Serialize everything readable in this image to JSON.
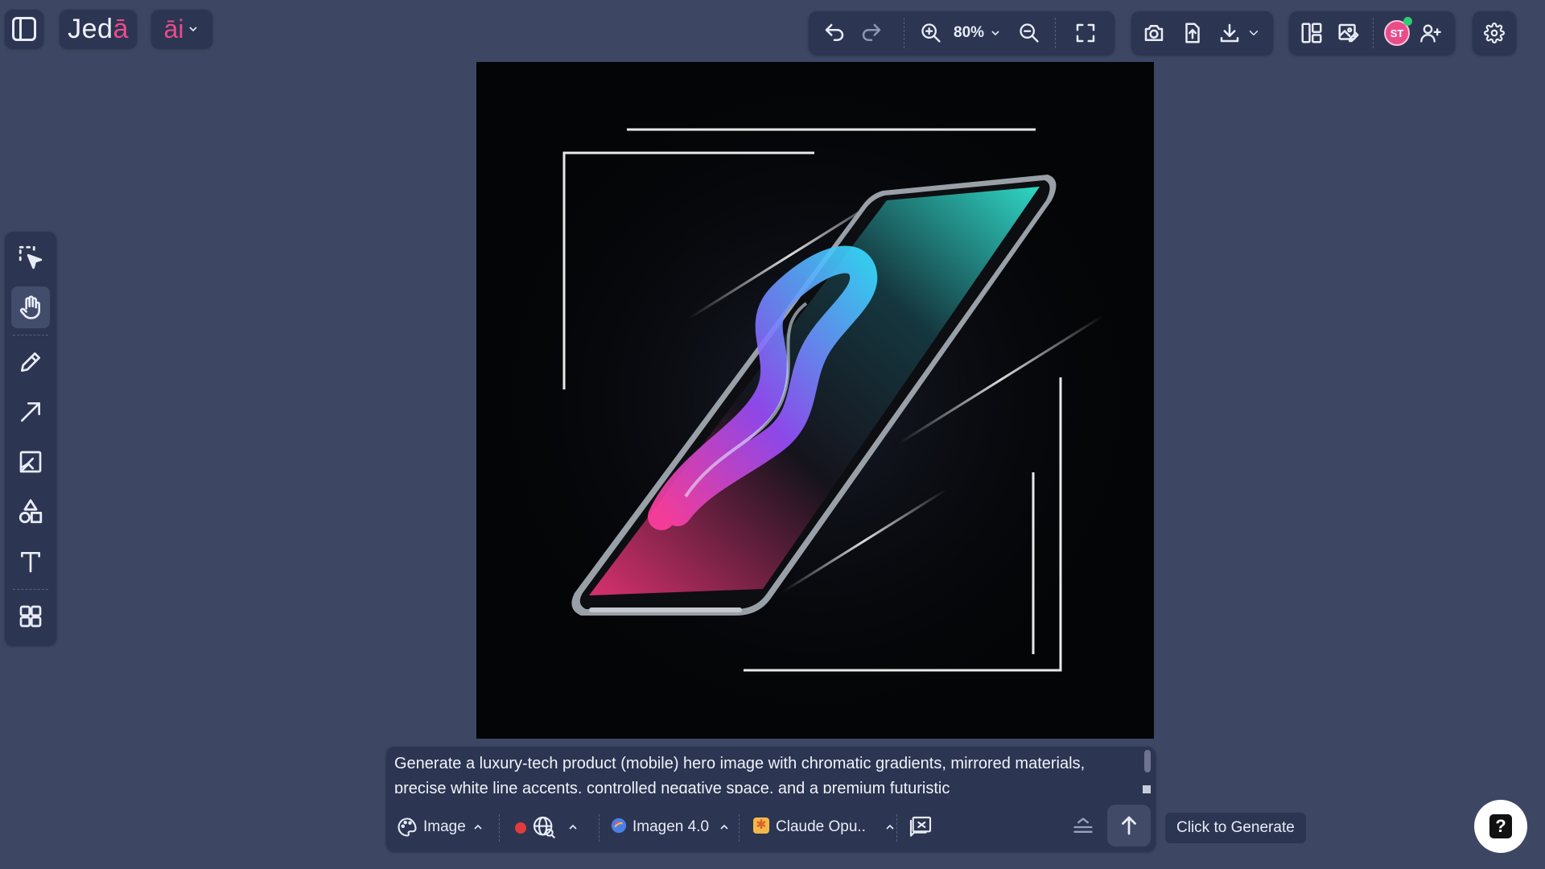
{
  "app": {
    "logo_text_pre": "Jed",
    "logo_text_accent": "ā",
    "ai_text": "āi"
  },
  "toolbar": {
    "zoom_label": "80%"
  },
  "user": {
    "avatar_initials": "ST"
  },
  "tools": [
    {
      "name": "select-tool",
      "icon": "select-arrow-icon"
    },
    {
      "name": "hand-tool",
      "icon": "hand-icon",
      "active": true
    },
    {
      "name": "pencil-tool",
      "icon": "pencil-icon"
    },
    {
      "name": "arrow-tool",
      "icon": "arrow-icon"
    },
    {
      "name": "image-tool",
      "icon": "image-icon"
    },
    {
      "name": "shapes-tool",
      "icon": "shapes-icon"
    },
    {
      "name": "text-tool",
      "icon": "text-icon"
    },
    {
      "name": "templates-tool",
      "icon": "grid-icon"
    }
  ],
  "prompt": {
    "text": "Generate a luxury-tech product (mobile) hero image with chromatic gradients, mirrored materials, precise white line accents, controlled negative space, and a premium futuristic",
    "mode_label": "Image",
    "model_label": "Imagen 4.0",
    "llm_label": "Claude Opu.."
  },
  "tooltip": {
    "generate": "Click to Generate"
  },
  "help": {
    "label": "?"
  },
  "colors": {
    "background": "#3d4764",
    "panel": "#2c3552",
    "accent_pink": "#e84d8a",
    "record_red": "#e23b3b",
    "online_green": "#2ecc71"
  }
}
